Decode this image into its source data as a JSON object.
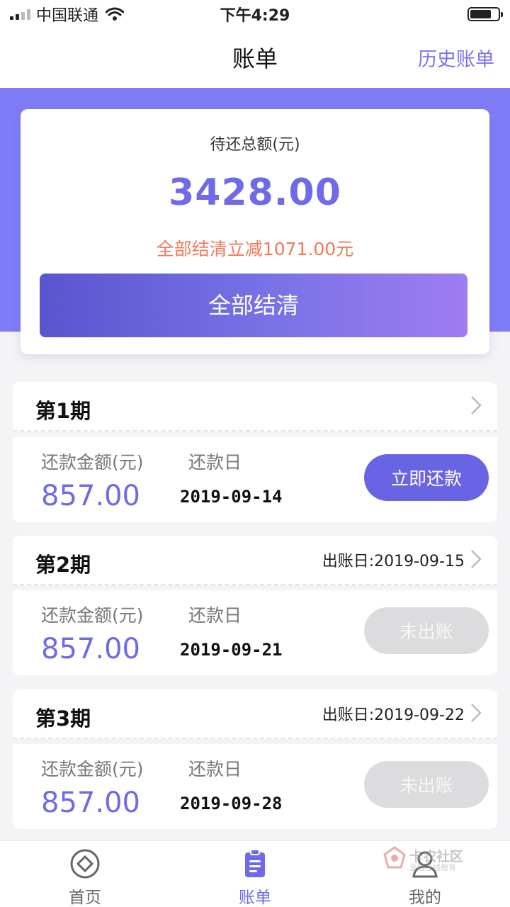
{
  "status_bar": {
    "carrier": "中国联通",
    "time": "下午4:29"
  },
  "nav": {
    "title": "账单",
    "right_link": "历史账单"
  },
  "summary": {
    "label": "待还总额(元)",
    "amount": "3428.00",
    "discount_note": "全部结清立减1071.00元",
    "settle_button": "全部结清"
  },
  "installments": [
    {
      "period": "第1期",
      "bill_date": "",
      "amount_label": "还款金额(元)",
      "amount": "857.00",
      "due_label": "还款日",
      "due_date": "2019-09-14",
      "action": "立即还款",
      "action_enabled": true
    },
    {
      "period": "第2期",
      "bill_date": "出账日:2019-09-15",
      "amount_label": "还款金额(元)",
      "amount": "857.00",
      "due_label": "还款日",
      "due_date": "2019-09-21",
      "action": "未出账",
      "action_enabled": false
    },
    {
      "period": "第3期",
      "bill_date": "出账日:2019-09-22",
      "amount_label": "还款金额(元)",
      "amount": "857.00",
      "due_label": "还款日",
      "due_date": "2019-09-28",
      "action": "未出账",
      "action_enabled": false
    }
  ],
  "tabs": [
    {
      "label": "首页",
      "icon": "home-icon",
      "active": false
    },
    {
      "label": "账单",
      "icon": "bill-icon",
      "active": true
    },
    {
      "label": "我的",
      "icon": "profile-icon",
      "active": false
    }
  ],
  "watermark": {
    "text": "卡农社区",
    "sub": "金融在线教育"
  },
  "colors": {
    "accent": "#6e6ae8",
    "band": "#7f7cf7",
    "discount": "#f07a5a",
    "disabled": "#dcdcdf"
  }
}
